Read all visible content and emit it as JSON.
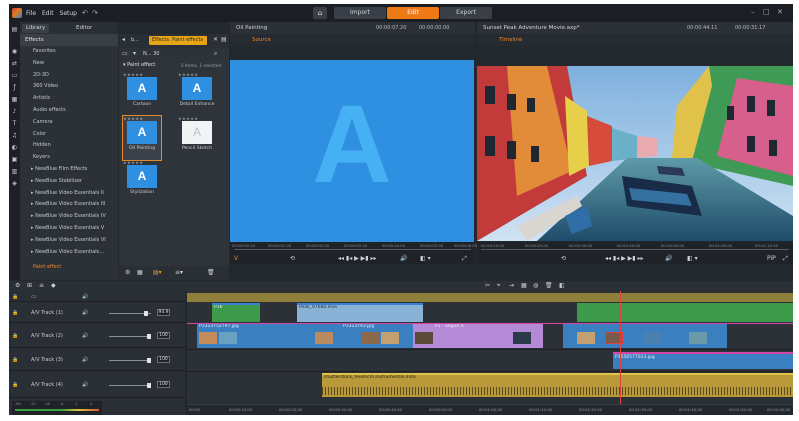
{
  "menu": [
    "File",
    "Edit",
    "Setup"
  ],
  "modes": {
    "import": "Import",
    "edit": "Edit",
    "export": "Export"
  },
  "library": {
    "tab_library": "Library",
    "tab_editor": "Editor",
    "heading": "Effects",
    "items": [
      "Favorites",
      "New",
      "2D-3D",
      "360 Video",
      "Artistic",
      "Audio effects",
      "Camera",
      "Color",
      "Hidden",
      "Keyers"
    ],
    "sub_items": [
      "NewBlue Film Effects",
      "NewBlue Stabilizer",
      "NewBlue Video Essentials II",
      "NewBlue Video Essentials III",
      "NewBlue Video Essentials IV",
      "NewBlue Video Essentials V",
      "NewBlue Video Essentials VI",
      "NewBlue Video Essentials..."
    ],
    "footer_item": "Paint effect"
  },
  "effects": {
    "crumb": "b...",
    "path": "Effects. Paint effects",
    "sub_label": "N... 30",
    "section": "Paint effect",
    "count": "5 Items, 1 selected",
    "cells": [
      {
        "label": "Cartoon",
        "glyph": "A"
      },
      {
        "label": "Detail Enhance",
        "glyph": "A"
      },
      {
        "label": "Oil Painting",
        "glyph": "A"
      },
      {
        "label": "Pencil Sketch",
        "glyph": "A"
      },
      {
        "label": "Stylization",
        "glyph": "A"
      }
    ]
  },
  "source_pane": {
    "title": "Oil Painting",
    "tab": "Source",
    "tc1": "00:00:07.20",
    "tc2": "00:00:00.00",
    "big_glyph": "A",
    "ruler": [
      "00:00:00.00",
      "00:00:01.00",
      "00:00:02.00",
      "00:00:03.00",
      "00:00:04.00",
      "00:00:05.00",
      "00:00:06.00"
    ]
  },
  "timeline_pane": {
    "title": "Sunset Peak Adventure Movie.axp*",
    "tab": "Timeline",
    "tc1": "00:00:44.11",
    "tc2": "00:00:31.17",
    "ruler": [
      "00:00:10.00",
      "00:00:20.00",
      "00:00:30.00",
      "00:00:40.00",
      "00:00:50.00",
      "00:01:00.00",
      "00:01:10.00"
    ],
    "pip": "PiP"
  },
  "tracks": [
    {
      "name": "A/V Track (1)",
      "volume": "94.9",
      "knob": 0.88
    },
    {
      "name": "A/V Track (2)",
      "volume": "100",
      "knob": 0.95
    },
    {
      "name": "A/V Track (3)",
      "volume": "100",
      "knob": 0.95
    },
    {
      "name": "A/V Track (4)",
      "volume": "100",
      "knob": 0.95
    }
  ],
  "clips": {
    "c1": "P16",
    "c2": "Peak_97680.mov",
    "c3": "P1313752797.jpg",
    "c4": "P1313743.jpg",
    "c5": "P1 - Segue A",
    "c6": "P1556577013.jpg",
    "audio": "shutterstock_feelmcm.Instrumental.m4a"
  },
  "bottom_ruler": [
    "00:00",
    "00:00:10.00",
    "00:00:20.00",
    "00:00:30.00",
    "00:00:40.00",
    "00:00:50.00",
    "00:01:00.00",
    "00:01:10.00",
    "00:01:20.00",
    "00:01:30.00",
    "00:01:40.00",
    "00:01:50.00",
    "00:02:00.00"
  ],
  "meter_labels": [
    "-60",
    "-22",
    "-16",
    "-6",
    "-3",
    "0"
  ]
}
